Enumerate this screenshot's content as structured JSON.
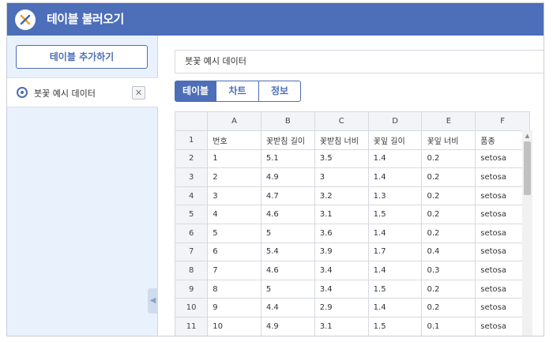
{
  "app": {
    "title": "테이블 불러오기",
    "accent_color": "#4d6eb8"
  },
  "sidebar": {
    "add_button_label": "테이블 추가하기",
    "items": [
      {
        "label": "붓꽃 예시 데이터",
        "icon": "compass-icon",
        "close_glyph": "✕"
      }
    ],
    "collapse_glyph": "◀"
  },
  "main": {
    "table_name_value": "붓꽃 예시 데이터",
    "tabs": [
      {
        "label": "테이블",
        "active": true
      },
      {
        "label": "차트",
        "active": false
      },
      {
        "label": "정보",
        "active": false
      }
    ],
    "grid": {
      "columns": [
        "A",
        "B",
        "C",
        "D",
        "E",
        "F"
      ],
      "rows": [
        {
          "n": "1",
          "cells": [
            "번호",
            "꽃받침 길이",
            "꽃받침 너비",
            "꽃잎 길이",
            "꽃잎 너비",
            "품종"
          ]
        },
        {
          "n": "2",
          "cells": [
            "1",
            "5.1",
            "3.5",
            "1.4",
            "0.2",
            "setosa"
          ]
        },
        {
          "n": "3",
          "cells": [
            "2",
            "4.9",
            "3",
            "1.4",
            "0.2",
            "setosa"
          ]
        },
        {
          "n": "4",
          "cells": [
            "3",
            "4.7",
            "3.2",
            "1.3",
            "0.2",
            "setosa"
          ]
        },
        {
          "n": "5",
          "cells": [
            "4",
            "4.6",
            "3.1",
            "1.5",
            "0.2",
            "setosa"
          ]
        },
        {
          "n": "6",
          "cells": [
            "5",
            "5",
            "3.6",
            "1.4",
            "0.2",
            "setosa"
          ]
        },
        {
          "n": "7",
          "cells": [
            "6",
            "5.4",
            "3.9",
            "1.7",
            "0.4",
            "setosa"
          ]
        },
        {
          "n": "8",
          "cells": [
            "7",
            "4.6",
            "3.4",
            "1.4",
            "0.3",
            "setosa"
          ]
        },
        {
          "n": "9",
          "cells": [
            "8",
            "5",
            "3.4",
            "1.5",
            "0.2",
            "setosa"
          ]
        },
        {
          "n": "10",
          "cells": [
            "9",
            "4.4",
            "2.9",
            "1.4",
            "0.2",
            "setosa"
          ]
        },
        {
          "n": "11",
          "cells": [
            "10",
            "4.9",
            "3.1",
            "1.5",
            "0.1",
            "setosa"
          ]
        }
      ]
    }
  }
}
